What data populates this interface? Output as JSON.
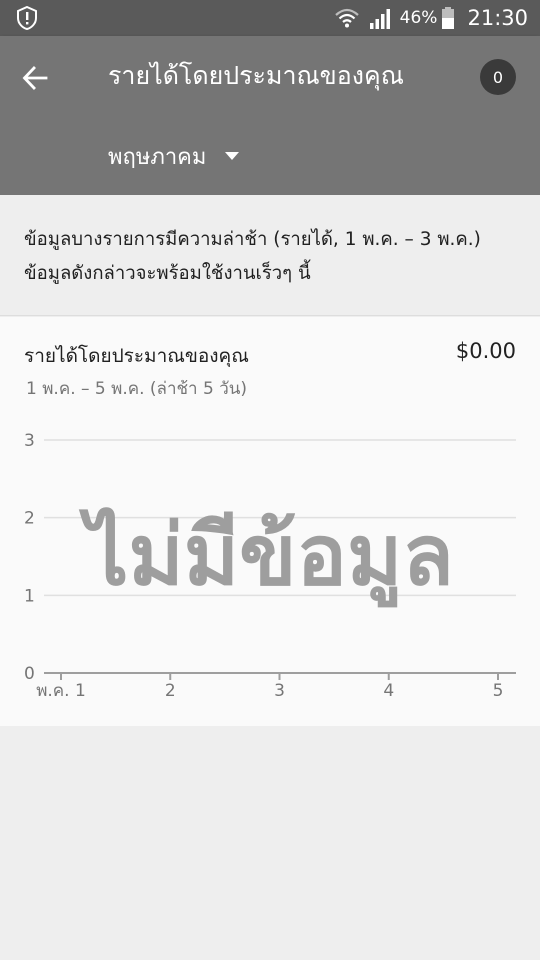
{
  "status_bar": {
    "battery_percent": "46%",
    "time": "21:30",
    "icons": [
      "alert-icon",
      "wifi-icon",
      "signal-icon",
      "battery-icon"
    ]
  },
  "app_bar": {
    "title": "รายได้โดยประมาณของคุณ",
    "badge_count": "0",
    "month": "พฤษภาคม",
    "background_color": "#757575"
  },
  "notice": {
    "text": "ข้อมูลบางรายการมีความล่าช้า (รายได้, 1 พ.ค. – 3 พ.ค.) ข้อมูลดังกล่าวจะพร้อมใช้งานเร็วๆ นี้"
  },
  "card": {
    "title": "รายได้โดยประมาณของคุณ",
    "amount": "$0.00",
    "subtitle": "1 พ.ค. – 5 พ.ค. (ล่าช้า 5 วัน)",
    "no_data_label": "ไม่มีข้อมูล"
  },
  "chart_data": {
    "type": "line",
    "title": "",
    "xlabel": "",
    "ylabel": "",
    "x_tick_labels": [
      "พ.ค. 1",
      "2",
      "3",
      "4",
      "5"
    ],
    "y_tick_labels": [
      "0",
      "1",
      "2",
      "3"
    ],
    "ylim": [
      0,
      3
    ],
    "grid": true,
    "series": []
  }
}
